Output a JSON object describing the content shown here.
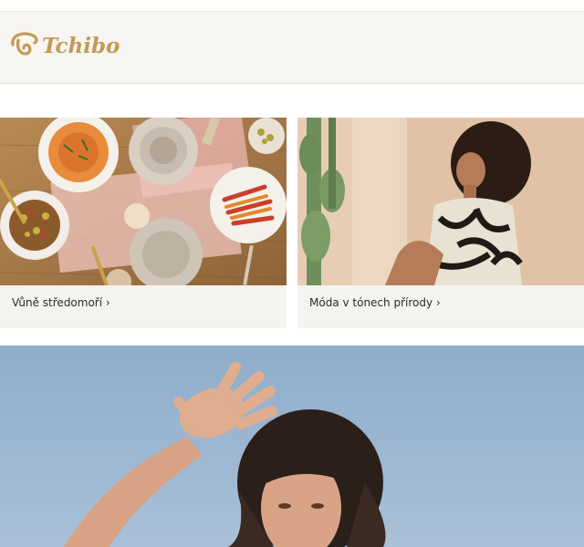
{
  "header": {
    "logo_text": "Tchibo"
  },
  "cards": [
    {
      "caption": "Vůně středomoří ›"
    },
    {
      "caption": "Móda v tónech přírody ›"
    }
  ],
  "colors": {
    "header_bg": "#f7f5f1",
    "logo_gold": "#c29a55",
    "card_bg": "#f5f3ef",
    "sky": "#9db7d2"
  }
}
